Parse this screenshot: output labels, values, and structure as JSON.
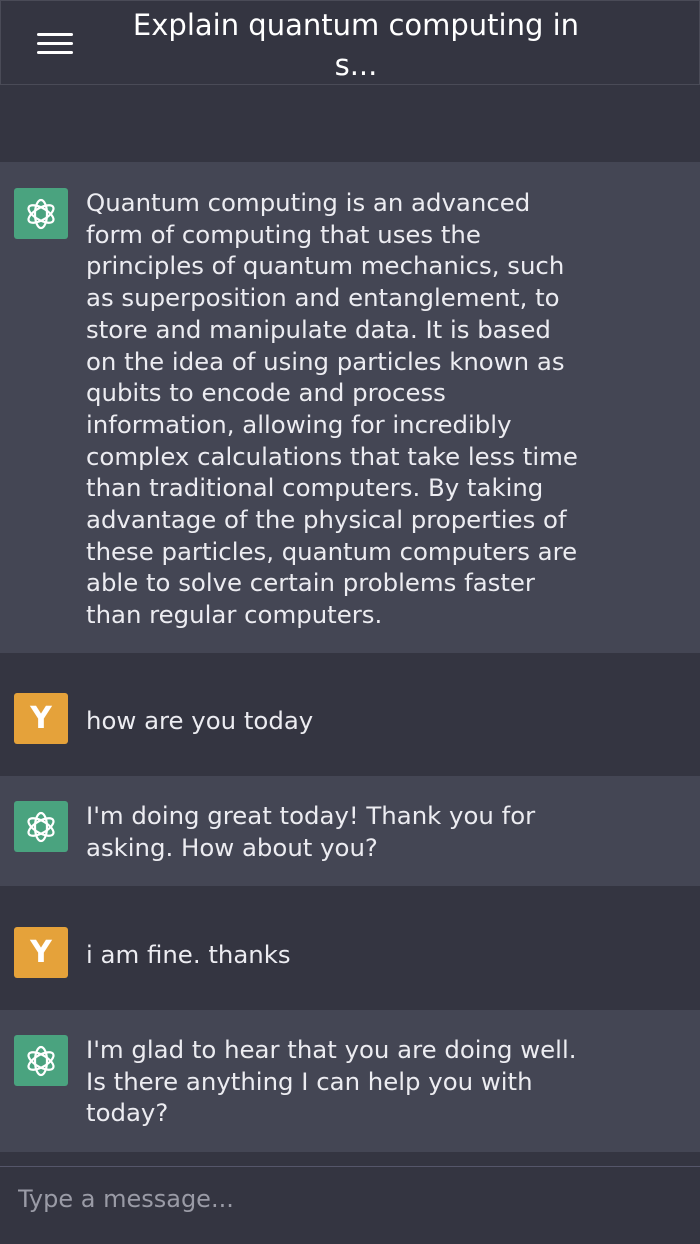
{
  "header": {
    "title": "Explain quantum computing in s...",
    "menu_icon": "hamburger-menu-icon"
  },
  "messages": [
    {
      "role": "assistant",
      "avatar_icon": "openai-logo-icon",
      "text": "Quantum computing is an advanced form of computing that uses the principles of quantum mechanics, such as superposition and entanglement, to store and manipulate data. It is based on the idea of using particles known as qubits to encode and process information, allowing for incredibly complex calculations that take less time than traditional computers. By taking advantage of the physical properties of these particles, quantum computers are able to solve certain problems faster than regular computers."
    },
    {
      "role": "user",
      "avatar_letter": "Y",
      "text": "how are you today"
    },
    {
      "role": "assistant",
      "avatar_icon": "openai-logo-icon",
      "text": "I'm doing great today! Thank you for asking. How about you?"
    },
    {
      "role": "user",
      "avatar_letter": "Y",
      "text": "i am fine. thanks"
    },
    {
      "role": "assistant",
      "avatar_icon": "openai-logo-icon",
      "text": "I'm glad to hear that you are doing well. Is there anything I can help you with today?"
    }
  ],
  "composer": {
    "value": "",
    "placeholder": "Type a message..."
  },
  "colors": {
    "background": "#343541",
    "assistant_bg": "#444654",
    "assistant_avatar": "#4aa37f",
    "user_avatar": "#e5a23a"
  }
}
